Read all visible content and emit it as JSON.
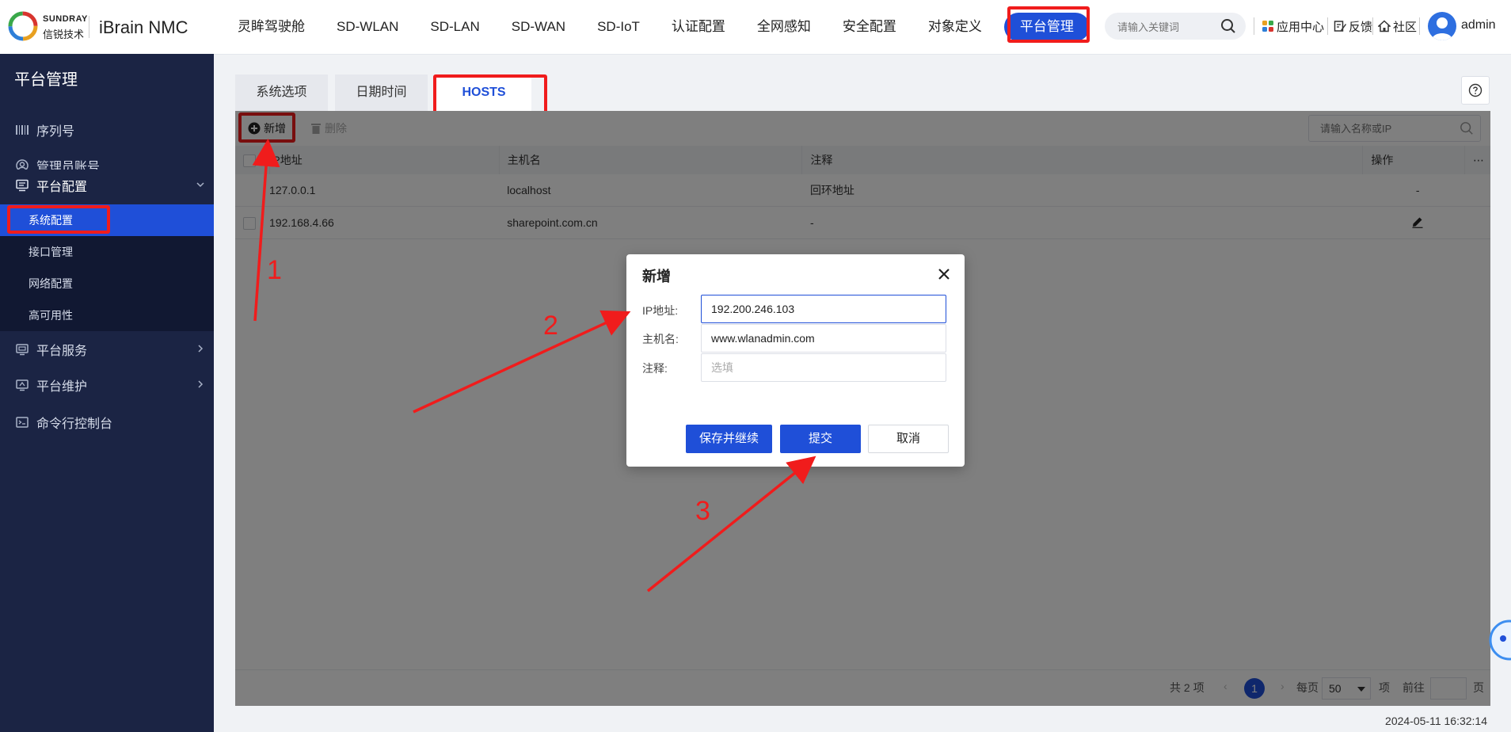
{
  "brand": {
    "en": "SUNDRAY",
    "cn": "信锐技术",
    "product": "iBrain NMC"
  },
  "nav": {
    "items": [
      "灵眸驾驶舱",
      "SD-WLAN",
      "SD-LAN",
      "SD-WAN",
      "SD-IoT",
      "认证配置",
      "全网感知",
      "安全配置",
      "对象定义"
    ],
    "active": "平台管理"
  },
  "header": {
    "search_placeholder": "请输入关键词",
    "tools": {
      "app_center": "应用中心",
      "feedback": "反馈",
      "community": "社区"
    },
    "user": "admin"
  },
  "sidebar": {
    "title": "平台管理",
    "items": [
      {
        "label": "序列号",
        "icon": "barcode-icon"
      },
      {
        "label": "管理员账号",
        "icon": "user-circle-icon"
      },
      {
        "label": "平台配置",
        "icon": "monitor-settings-icon"
      },
      {
        "label": "平台服务",
        "icon": "service-icon"
      },
      {
        "label": "平台维护",
        "icon": "maintenance-icon"
      },
      {
        "label": "命令行控制台",
        "icon": "terminal-icon"
      }
    ],
    "sub_items": [
      "系统配置",
      "接口管理",
      "网络配置",
      "高可用性"
    ],
    "active_sub": "系统配置"
  },
  "tabs": [
    "系统选项",
    "日期时间",
    "HOSTS"
  ],
  "active_tab": "HOSTS",
  "toolbar": {
    "add": "新增",
    "delete": "删除",
    "search_placeholder": "请输入名称或IP"
  },
  "table": {
    "columns": [
      "IP地址",
      "主机名",
      "注释",
      "操作"
    ],
    "rows": [
      {
        "ip": "127.0.0.1",
        "host": "localhost",
        "note": "回环地址",
        "op": "-"
      },
      {
        "ip": "192.168.4.66",
        "host": "sharepoint.com.cn",
        "note": "-",
        "op": "edit-icon"
      }
    ]
  },
  "pagination": {
    "total": "共 2 项",
    "current_page": "1",
    "per_page_label": "每页",
    "page_size": "50",
    "unit": "项",
    "goto": "前往",
    "page_suffix": "页"
  },
  "timestamp": "2024-05-11 16:32:14",
  "modal": {
    "title": "新增",
    "fields": [
      {
        "label": "IP地址:",
        "value": "192.200.246.103",
        "placeholder": ""
      },
      {
        "label": "主机名:",
        "value": "www.wlanadmin.com",
        "placeholder": ""
      },
      {
        "label": "注释:",
        "value": "",
        "placeholder": "选填"
      }
    ],
    "buttons": {
      "save_continue": "保存并继续",
      "submit": "提交",
      "cancel": "取消"
    }
  },
  "annotations": {
    "step1": "1",
    "step2": "2",
    "step3": "3"
  },
  "colors": {
    "accent": "#1f4fd8",
    "highlight": "#f01c1c",
    "sidebar": "#1b2444"
  }
}
